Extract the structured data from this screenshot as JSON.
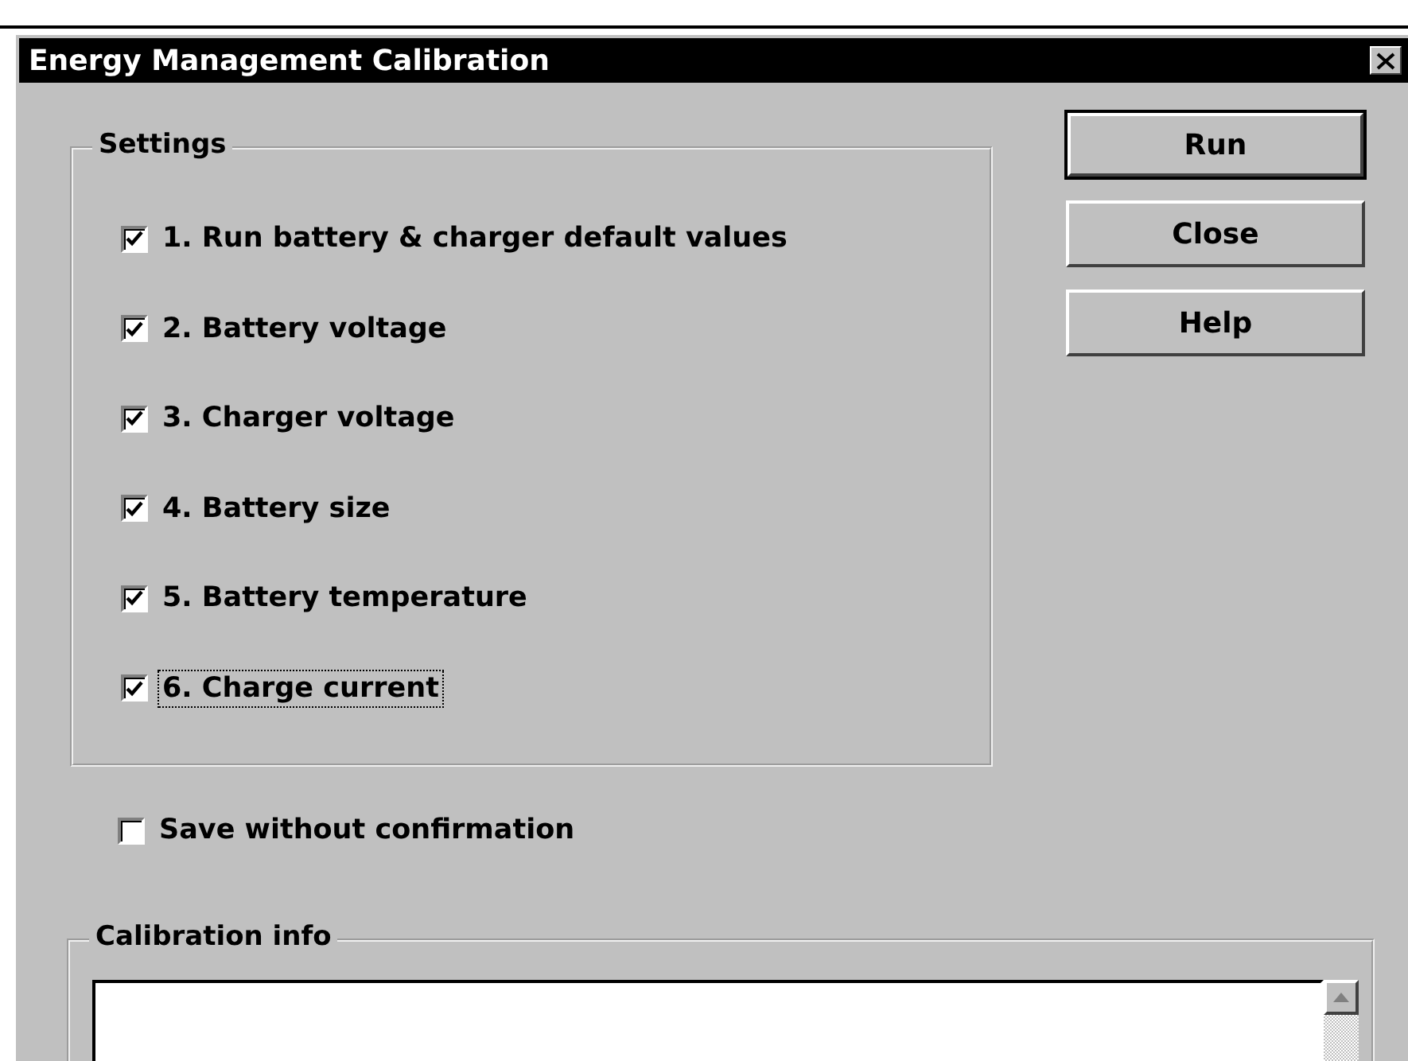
{
  "window": {
    "title": "Energy Management Calibration"
  },
  "settings": {
    "title": "Settings",
    "items": [
      {
        "label": "1. Run battery & charger default values",
        "checked": true,
        "focused": false
      },
      {
        "label": "2. Battery voltage",
        "checked": true,
        "focused": false
      },
      {
        "label": "3. Charger voltage",
        "checked": true,
        "focused": false
      },
      {
        "label": "4. Battery size",
        "checked": true,
        "focused": false
      },
      {
        "label": "5. Battery temperature",
        "checked": true,
        "focused": false
      },
      {
        "label": "6. Charge current",
        "checked": true,
        "focused": true
      }
    ]
  },
  "save_option": {
    "label": "Save without confirmation",
    "checked": false
  },
  "buttons": [
    {
      "label": "Run",
      "default": true
    },
    {
      "label": "Close",
      "default": false
    },
    {
      "label": "Help",
      "default": false
    }
  ],
  "calibration_info": {
    "title": "Calibration info"
  }
}
